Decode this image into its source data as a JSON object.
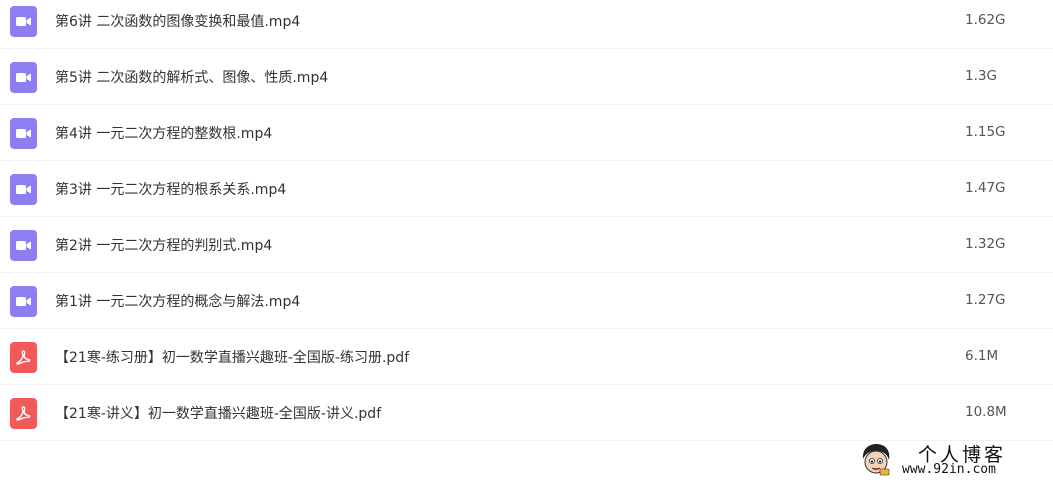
{
  "files": [
    {
      "type": "video",
      "icon": "video-camera-icon",
      "name": "第6讲 二次函数的图像变换和最值.mp4",
      "size": "1.62G"
    },
    {
      "type": "video",
      "icon": "video-camera-icon",
      "name": "第5讲 二次函数的解析式、图像、性质.mp4",
      "size": "1.3G"
    },
    {
      "type": "video",
      "icon": "video-camera-icon",
      "name": "第4讲 一元二次方程的整数根.mp4",
      "size": "1.15G"
    },
    {
      "type": "video",
      "icon": "video-camera-icon",
      "name": "第3讲 一元二次方程的根系关系.mp4",
      "size": "1.47G"
    },
    {
      "type": "video",
      "icon": "video-camera-icon",
      "name": "第2讲 一元二次方程的判别式.mp4",
      "size": "1.32G"
    },
    {
      "type": "video",
      "icon": "video-camera-icon",
      "name": "第1讲 一元二次方程的概念与解法.mp4",
      "size": "1.27G"
    },
    {
      "type": "pdf",
      "icon": "pdf-icon",
      "name": "【21寒-练习册】初一数学直播兴趣班-全国版-练习册.pdf",
      "size": "6.1M"
    },
    {
      "type": "pdf",
      "icon": "pdf-icon",
      "name": "【21寒-讲义】初一数学直播兴趣班-全国版-讲义.pdf",
      "size": "10.8M"
    }
  ],
  "colors": {
    "video_icon": "#8c7ff0",
    "pdf_icon": "#f25a5a",
    "row_divider": "#eef0f4",
    "text": "#333333"
  },
  "watermark": {
    "title": "个人博客",
    "url": "www.92in.com",
    "icon": "cartoon-avatar-icon"
  }
}
